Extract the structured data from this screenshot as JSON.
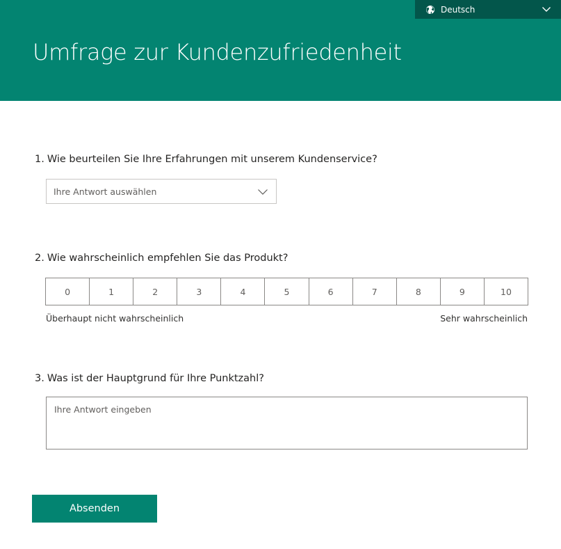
{
  "header": {
    "title": "Umfrage zur Kundenzufriedenheit",
    "background_color": "#038471"
  },
  "language_selector": {
    "label": "Deutsch",
    "icon": "globe-icon",
    "chevron_icon": "chevron-down-icon",
    "background_color": "#03564b"
  },
  "questions": [
    {
      "number": "1.",
      "text": "Wie beurteilen Sie Ihre Erfahrungen mit unserem Kundenservice?",
      "select_placeholder": "Ihre Antwort auswählen"
    },
    {
      "number": "2.",
      "text": "Wie wahrscheinlich empfehlen Sie das Produkt?",
      "scale": [
        "0",
        "1",
        "2",
        "3",
        "4",
        "5",
        "6",
        "7",
        "8",
        "9",
        "10"
      ],
      "low_label": "Überhaupt nicht wahrscheinlich",
      "high_label": "Sehr wahrscheinlich"
    },
    {
      "number": "3.",
      "text": "Was ist der Hauptgrund für Ihre Punktzahl?",
      "textarea_placeholder": "Ihre Antwort eingeben"
    }
  ],
  "submit": {
    "label": "Absenden",
    "background_color": "#038471"
  }
}
